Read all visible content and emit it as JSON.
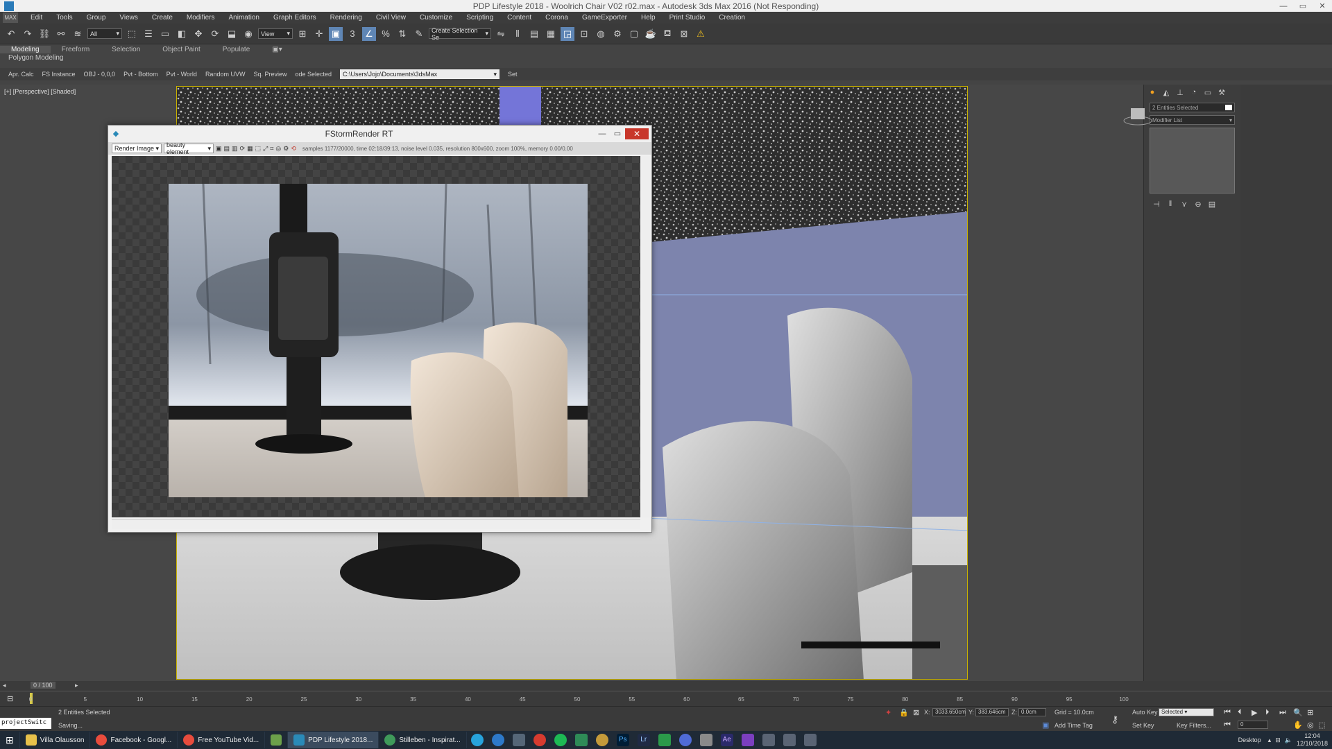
{
  "window": {
    "title": "PDP Lifestyle 2018 - Woolrich Chair V02 r02.max - Autodesk 3ds Max 2016 (Not Responding)",
    "min": "—",
    "max": "▭",
    "close": "✕"
  },
  "menu": [
    "Edit",
    "Tools",
    "Group",
    "Views",
    "Create",
    "Modifiers",
    "Animation",
    "Graph Editors",
    "Rendering",
    "Civil View",
    "Customize",
    "Scripting",
    "Content",
    "Corona",
    "GameExporter",
    "Help",
    "Print Studio",
    "Creation"
  ],
  "menu_logo": "MAX",
  "toolbar": {
    "filter_select": "All",
    "view_select": "View",
    "selection_set": "Create Selection Se"
  },
  "ribbon": {
    "tabs": [
      "Modeling",
      "Freeform",
      "Selection",
      "Object Paint",
      "Populate"
    ],
    "active_tab": "Modeling",
    "sub_label": "Polygon Modeling"
  },
  "subbar": {
    "buttons": [
      "Apr. Calc",
      "FS Instance",
      "OBJ - 0,0,0",
      "Pvt - Bottom",
      "Pvt - World",
      "Random UVW",
      "Sq. Preview",
      "ode Selected"
    ],
    "path": "C:\\Users\\Jojo\\Documents\\3dsMax",
    "set_label": "Set"
  },
  "viewport": {
    "label": "[+] [Perspective] [Shaded]"
  },
  "fstorm": {
    "title": "FStormRender RT",
    "render_select": "Render Image",
    "element_select": "beauty element",
    "status": "samples 1177/20000, time 02:18/39:13, noise level 0.035, resolution 800x600, zoom 100%, memory 0.00/0.00"
  },
  "command_panel": {
    "selection_info": "2 Entities Selected",
    "modifier_list": "Modifier List"
  },
  "timeline": {
    "frame_display": "0 / 100",
    "ticks": [
      "0",
      "5",
      "10",
      "15",
      "20",
      "25",
      "30",
      "35",
      "40",
      "45",
      "50",
      "55",
      "60",
      "65",
      "70",
      "75",
      "80",
      "85",
      "90",
      "95",
      "100"
    ]
  },
  "status": {
    "selected_text": "2 Entities Selected",
    "saving_text": "Saving...",
    "script_field": "projectSwitc",
    "x_label": "X:",
    "x_value": "3033.650cm",
    "y_label": "Y:",
    "y_value": "383.646cm",
    "z_label": "Z:",
    "z_value": "0.0cm",
    "grid": "Grid = 10.0cm",
    "add_time_tag": "Add Time Tag",
    "auto_key": "Auto Key",
    "set_key": "Set Key",
    "key_mode_select": "Selected",
    "key_filters": "Key Filters...",
    "frame_value": "0"
  },
  "taskbar": {
    "apps": [
      {
        "label": "Villa Olausson",
        "color": "#e8c14a"
      },
      {
        "label": "Facebook - Googl...",
        "color": "#e84c3d"
      },
      {
        "label": "Free YouTube Vid...",
        "color": "#e84c3d"
      },
      {
        "label": "",
        "color": "#6ca04a"
      },
      {
        "label": "PDP Lifestyle 2018...",
        "color": "#2a8ab8"
      },
      {
        "label": "Stilleben - Inspirat...",
        "color": "#3f9a5a"
      }
    ],
    "tray_colors": [
      "#27a3dc",
      "#2d79c9",
      "#556677",
      "#d63b2f",
      "#1db954",
      "#2e8b57",
      "#c49a3a",
      "#001d35",
      "#1f2a44",
      "#2b9a4a",
      "#4f6bd6",
      "#2a2a6a",
      "#7b3fbf",
      "#8a8a8a",
      "#8a8a8a",
      "#8a8a8a"
    ],
    "tray_labels": [
      "Ps",
      "Lr",
      "Ae"
    ],
    "desktop": "Desktop",
    "time": "12:04",
    "date": "12/10/2018"
  }
}
